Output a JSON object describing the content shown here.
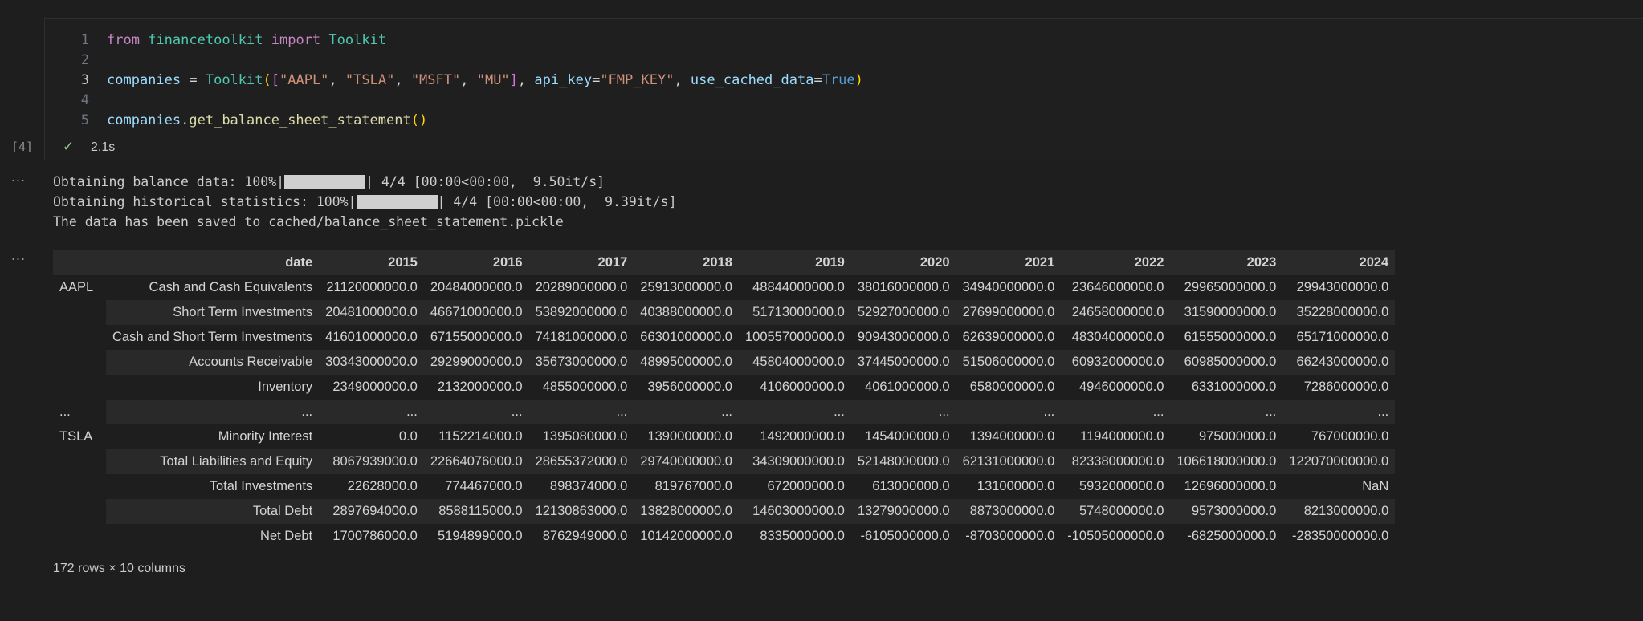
{
  "cell": {
    "exec_count": "[4]",
    "exec_time": "2.1s",
    "code": [
      {
        "n": "1",
        "tokens": [
          [
            "kw",
            "from"
          ],
          [
            "plain",
            " "
          ],
          [
            "mod",
            "financetoolkit"
          ],
          [
            "plain",
            " "
          ],
          [
            "kw",
            "import"
          ],
          [
            "plain",
            " "
          ],
          [
            "mod",
            "Toolkit"
          ]
        ]
      },
      {
        "n": "2",
        "tokens": []
      },
      {
        "n": "3",
        "tokens": [
          [
            "var",
            "companies"
          ],
          [
            "plain",
            " = "
          ],
          [
            "mod",
            "Toolkit"
          ],
          [
            "brk",
            "("
          ],
          [
            "brk2",
            "["
          ],
          [
            "str",
            "\"AAPL\""
          ],
          [
            "plain",
            ", "
          ],
          [
            "str",
            "\"TSLA\""
          ],
          [
            "plain",
            ", "
          ],
          [
            "str",
            "\"MSFT\""
          ],
          [
            "plain",
            ", "
          ],
          [
            "str",
            "\"MU\""
          ],
          [
            "brk2",
            "]"
          ],
          [
            "plain",
            ", "
          ],
          [
            "var",
            "api_key"
          ],
          [
            "plain",
            "="
          ],
          [
            "str",
            "\"FMP_KEY\""
          ],
          [
            "plain",
            ", "
          ],
          [
            "var",
            "use_cached_data"
          ],
          [
            "plain",
            "="
          ],
          [
            "bool",
            "True"
          ],
          [
            "brk",
            ")"
          ]
        ]
      },
      {
        "n": "4",
        "tokens": []
      },
      {
        "n": "5",
        "tokens": [
          [
            "var",
            "companies"
          ],
          [
            "plain",
            "."
          ],
          [
            "fn",
            "get_balance_sheet_statement"
          ],
          [
            "brk",
            "()"
          ]
        ]
      }
    ]
  },
  "stream": {
    "line1_pre": "Obtaining balance data: 100%|",
    "line1_post": "| 4/4 [00:00<00:00,  9.50it/s]",
    "line2_pre": "Obtaining historical statistics: 100%|",
    "line2_post": "| 4/4 [00:00<00:00,  9.39it/s]",
    "line3": "The data has been saved to cached/balance_sheet_statement.pickle",
    "progress_1": 1.0,
    "progress_2": 1.0
  },
  "table": {
    "header_label": "date",
    "columns": [
      "2015",
      "2016",
      "2017",
      "2018",
      "2019",
      "2020",
      "2021",
      "2022",
      "2023",
      "2024"
    ],
    "rows": [
      {
        "i0": "AAPL",
        "i1": "Cash and Cash Equivalents",
        "v": [
          "21120000000.0",
          "20484000000.0",
          "20289000000.0",
          "25913000000.0",
          "48844000000.0",
          "38016000000.0",
          "34940000000.0",
          "23646000000.0",
          "29965000000.0",
          "29943000000.0"
        ]
      },
      {
        "i0": "",
        "i1": "Short Term Investments",
        "v": [
          "20481000000.0",
          "46671000000.0",
          "53892000000.0",
          "40388000000.0",
          "51713000000.0",
          "52927000000.0",
          "27699000000.0",
          "24658000000.0",
          "31590000000.0",
          "35228000000.0"
        ]
      },
      {
        "i0": "",
        "i1": "Cash and Short Term Investments",
        "v": [
          "41601000000.0",
          "67155000000.0",
          "74181000000.0",
          "66301000000.0",
          "100557000000.0",
          "90943000000.0",
          "62639000000.0",
          "48304000000.0",
          "61555000000.0",
          "65171000000.0"
        ]
      },
      {
        "i0": "",
        "i1": "Accounts Receivable",
        "v": [
          "30343000000.0",
          "29299000000.0",
          "35673000000.0",
          "48995000000.0",
          "45804000000.0",
          "37445000000.0",
          "51506000000.0",
          "60932000000.0",
          "60985000000.0",
          "66243000000.0"
        ]
      },
      {
        "i0": "",
        "i1": "Inventory",
        "v": [
          "2349000000.0",
          "2132000000.0",
          "4855000000.0",
          "3956000000.0",
          "4106000000.0",
          "4061000000.0",
          "6580000000.0",
          "4946000000.0",
          "6331000000.0",
          "7286000000.0"
        ]
      },
      {
        "i0": "...",
        "i1": "...",
        "v": [
          "...",
          "...",
          "...",
          "...",
          "...",
          "...",
          "...",
          "...",
          "...",
          "..."
        ]
      },
      {
        "i0": "TSLA",
        "i1": "Minority Interest",
        "v": [
          "0.0",
          "1152214000.0",
          "1395080000.0",
          "1390000000.0",
          "1492000000.0",
          "1454000000.0",
          "1394000000.0",
          "1194000000.0",
          "975000000.0",
          "767000000.0"
        ]
      },
      {
        "i0": "",
        "i1": "Total Liabilities and Equity",
        "v": [
          "8067939000.0",
          "22664076000.0",
          "28655372000.0",
          "29740000000.0",
          "34309000000.0",
          "52148000000.0",
          "62131000000.0",
          "82338000000.0",
          "106618000000.0",
          "122070000000.0"
        ]
      },
      {
        "i0": "",
        "i1": "Total Investments",
        "v": [
          "22628000.0",
          "774467000.0",
          "898374000.0",
          "819767000.0",
          "672000000.0",
          "613000000.0",
          "131000000.0",
          "5932000000.0",
          "12696000000.0",
          "NaN"
        ]
      },
      {
        "i0": "",
        "i1": "Total Debt",
        "v": [
          "2897694000.0",
          "8588115000.0",
          "12130863000.0",
          "13828000000.0",
          "14603000000.0",
          "13279000000.0",
          "8873000000.0",
          "5748000000.0",
          "9573000000.0",
          "8213000000.0"
        ]
      },
      {
        "i0": "",
        "i1": "Net Debt",
        "v": [
          "1700786000.0",
          "5194899000.0",
          "8762949000.0",
          "10142000000.0",
          "8335000000.0",
          "-6105000000.0",
          "-8703000000.0",
          "-10505000000.0",
          "-6825000000.0",
          "-28350000000.0"
        ]
      }
    ],
    "footer": "172 rows × 10 columns"
  },
  "ui": {
    "more_label": "...",
    "check_glyph": "✓"
  }
}
